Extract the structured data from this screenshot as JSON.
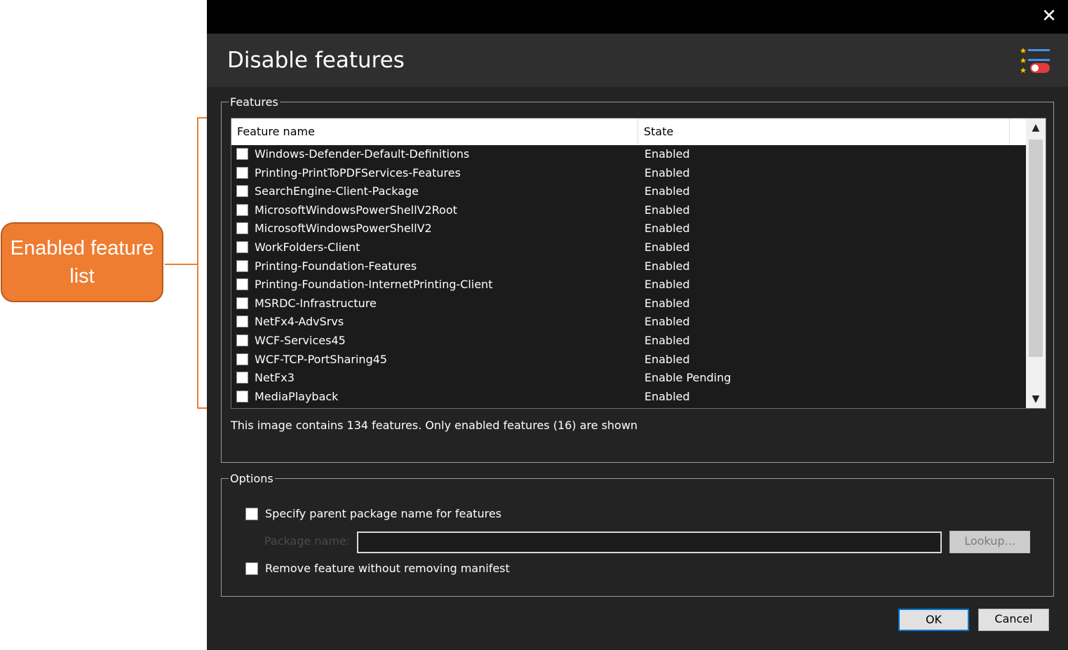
{
  "annotation": {
    "callout_text": "Enabled feature list"
  },
  "dialog": {
    "close_symbol": "✕",
    "title": "Disable features",
    "header_icon": "feature-toggle-icon",
    "features_group": {
      "legend": "Features",
      "columns": [
        "Feature name",
        "State"
      ],
      "rows": [
        {
          "name": "Windows-Defender-Default-Definitions",
          "state": "Enabled",
          "checked": false
        },
        {
          "name": "Printing-PrintToPDFServices-Features",
          "state": "Enabled",
          "checked": false
        },
        {
          "name": "SearchEngine-Client-Package",
          "state": "Enabled",
          "checked": false
        },
        {
          "name": "MicrosoftWindowsPowerShellV2Root",
          "state": "Enabled",
          "checked": false
        },
        {
          "name": "MicrosoftWindowsPowerShellV2",
          "state": "Enabled",
          "checked": false
        },
        {
          "name": "WorkFolders-Client",
          "state": "Enabled",
          "checked": false
        },
        {
          "name": "Printing-Foundation-Features",
          "state": "Enabled",
          "checked": false
        },
        {
          "name": "Printing-Foundation-InternetPrinting-Client",
          "state": "Enabled",
          "checked": false
        },
        {
          "name": "MSRDC-Infrastructure",
          "state": "Enabled",
          "checked": false
        },
        {
          "name": "NetFx4-AdvSrvs",
          "state": "Enabled",
          "checked": false
        },
        {
          "name": "WCF-Services45",
          "state": "Enabled",
          "checked": false
        },
        {
          "name": "WCF-TCP-PortSharing45",
          "state": "Enabled",
          "checked": false
        },
        {
          "name": "NetFx3",
          "state": "Enable Pending",
          "checked": false
        },
        {
          "name": "MediaPlayback",
          "state": "Enabled",
          "checked": false
        }
      ],
      "scroll_up": "▲",
      "scroll_down": "▼",
      "info_text": "This image contains 134 features. Only enabled features (16) are shown"
    },
    "options_group": {
      "legend": "Options",
      "specify_parent_label": "Specify parent package name for features",
      "specify_parent_checked": false,
      "package_name_label": "Package name:",
      "package_name_value": "",
      "lookup_label": "Lookup...",
      "remove_manifest_label": "Remove feature without removing manifest",
      "remove_manifest_checked": false
    },
    "ok_label": "OK",
    "cancel_label": "Cancel"
  },
  "colors": {
    "accent": "#ee7d31",
    "ok_border": "#0078d7",
    "dialog_bg": "#232323"
  }
}
